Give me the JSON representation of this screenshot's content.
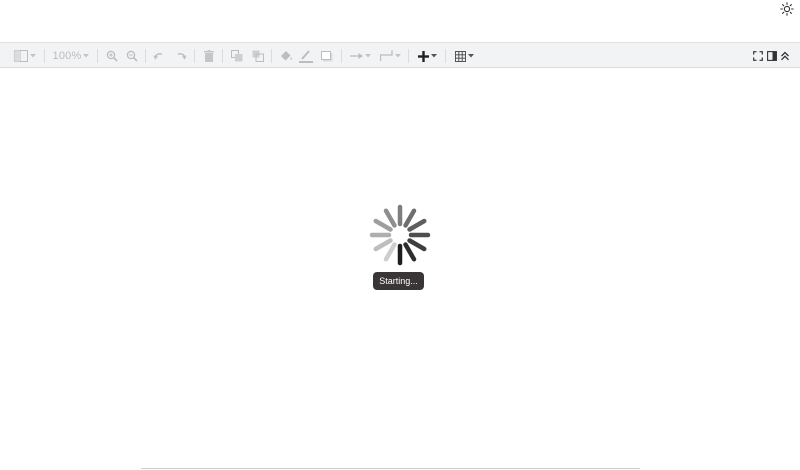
{
  "header": {
    "theme_icon": "sun-icon"
  },
  "toolbar": {
    "zoom_value": "100%",
    "icons": [
      "format-panel-icon",
      "zoom-in-icon",
      "zoom-out-icon",
      "undo-icon",
      "redo-icon",
      "delete-icon",
      "to-front-icon",
      "to-back-icon",
      "fill-color-icon",
      "line-color-icon",
      "shadow-icon",
      "connection-icon",
      "waypoints-icon",
      "insert-icon",
      "table-icon",
      "fullscreen-icon",
      "toggle-panel-icon",
      "collapse-icon"
    ]
  },
  "status": {
    "text": "Starting..."
  },
  "colors": {
    "toolbar_bg": "#f1f3f4",
    "status_bg": "#3a3536",
    "disabled_icon": "#bdbdbd",
    "active_icon": "#222222"
  }
}
